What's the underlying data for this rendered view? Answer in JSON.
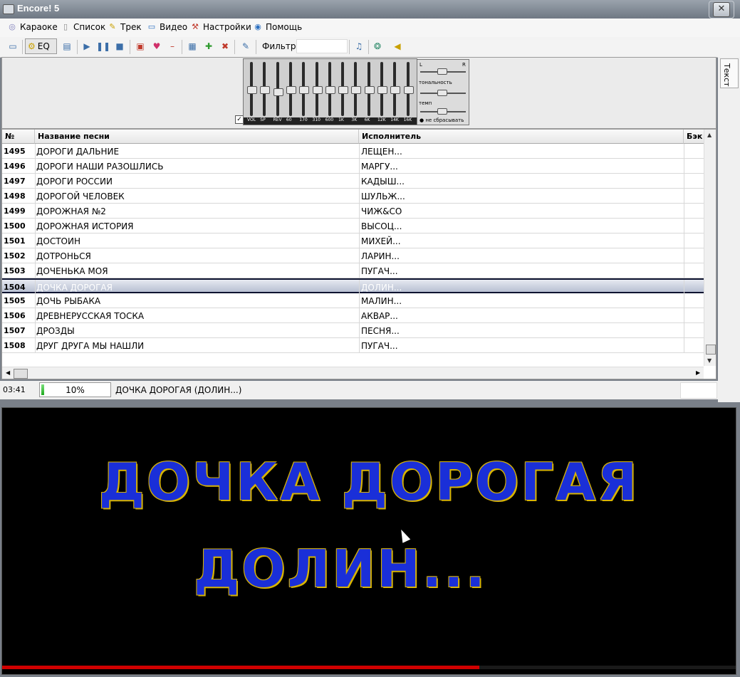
{
  "window": {
    "title": "Encore! 5"
  },
  "menu": [
    {
      "label": "Караоке",
      "icon": "karaoke-icon"
    },
    {
      "label": "Список",
      "icon": "list-icon"
    },
    {
      "label": "Трек",
      "icon": "track-icon"
    },
    {
      "label": "Видео",
      "icon": "video-icon"
    },
    {
      "label": "Настройки",
      "icon": "settings-icon"
    },
    {
      "label": "Помощь",
      "icon": "help-icon"
    }
  ],
  "toolbar": {
    "eq_label": "EQ",
    "filter_label": "Фильтр",
    "filter_value": ""
  },
  "side_tab": {
    "label": "Текст"
  },
  "equalizer": {
    "labels": [
      "VOL",
      "SP",
      "REV",
      "60",
      "170",
      "310",
      "600",
      "1K",
      "3K",
      "6K",
      "12K",
      "14K",
      "16K"
    ],
    "levels": [
      0.5,
      0.5,
      0.45,
      0.5,
      0.5,
      0.5,
      0.5,
      0.5,
      0.5,
      0.5,
      0.5,
      0.5,
      0.5
    ],
    "enabled": true
  },
  "tempo": {
    "tone_label": "тональность",
    "tempo_label": "темп",
    "no_reset_label": "не сбрасывать",
    "lr_left": "L",
    "lr_right": "R"
  },
  "table": {
    "headers": {
      "num": "№",
      "song": "Название песни",
      "artist": "Исполнитель",
      "back": "Бэк"
    },
    "rows": [
      {
        "num": "1495",
        "song": "ДОРОГИ ДАЛЬНИЕ",
        "artist": "ЛЕЩЕН..."
      },
      {
        "num": "1496",
        "song": "ДОРОГИ НАШИ РАЗОШЛИСЬ",
        "artist": "МАРГУ..."
      },
      {
        "num": "1497",
        "song": "ДОРОГИ РОССИИ",
        "artist": "КАДЫШ..."
      },
      {
        "num": "1498",
        "song": "ДОРОГОЙ ЧЕЛОВЕК",
        "artist": "ШУЛЬЖ..."
      },
      {
        "num": "1499",
        "song": "ДОРОЖНАЯ №2",
        "artist": "ЧИЖ&CO"
      },
      {
        "num": "1500",
        "song": "ДОРОЖНАЯ ИСТОРИЯ",
        "artist": "ВЫСОЦ..."
      },
      {
        "num": "1501",
        "song": "ДОСТОИН",
        "artist": "МИХЕЙ..."
      },
      {
        "num": "1502",
        "song": "ДОТРОНЬСЯ",
        "artist": "ЛАРИН..."
      },
      {
        "num": "1503",
        "song": "ДОЧЕНЬКА МОЯ",
        "artist": "ПУГАЧ..."
      },
      {
        "num": "1504",
        "song": "ДОЧКА ДОРОГАЯ",
        "artist": "ДОЛИН...",
        "selected": true
      },
      {
        "num": "1505",
        "song": "ДОЧЬ РЫБАКА",
        "artist": "МАЛИН..."
      },
      {
        "num": "1506",
        "song": "ДРЕВНЕРУССКАЯ ТОСКА",
        "artist": "АКВАР..."
      },
      {
        "num": "1507",
        "song": "ДРОЗДЫ",
        "artist": "ПЕСНЯ..."
      },
      {
        "num": "1508",
        "song": "ДРУГ ДРУГА МЫ НАШЛИ",
        "artist": "ПУГАЧ..."
      }
    ]
  },
  "status": {
    "time": "03:41",
    "progress_text": "10%",
    "progress": 0.1,
    "current_song": "ДОЧКА ДОРОГАЯ (ДОЛИН...)"
  },
  "video": {
    "line1": "ДОЧКА ДОРОГАЯ",
    "line2": "ДОЛИН...",
    "playback_progress": 0.65
  },
  "colors": {
    "lyric_fill": "#1a2fd8",
    "lyric_outline": "#d8b400",
    "progress_bar": "#d00000",
    "selection": "#0e1330"
  }
}
